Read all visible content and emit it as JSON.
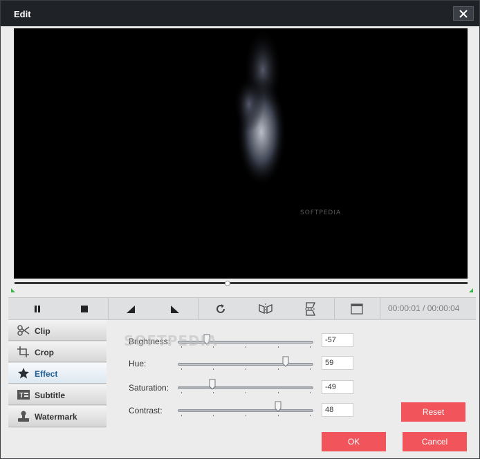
{
  "window": {
    "title": "Edit"
  },
  "preview": {
    "watermark": "SOFTPEDIA"
  },
  "player": {
    "progress": 0.47,
    "current_time": "00:00:01",
    "separator": "/",
    "total_time": "00:00:04",
    "timecode": "00:00:01 / 00:00:04"
  },
  "toolbar": {
    "icons": [
      "pause-icon",
      "stop-icon",
      "rotate-left-icon",
      "rotate-right-icon",
      "rotate-clockwise-icon",
      "flip-horizontal-icon",
      "flip-vertical-icon",
      "aspect-ratio-icon"
    ]
  },
  "sidebar": {
    "items": [
      {
        "label": "Clip",
        "icon": "scissors-icon",
        "active": false
      },
      {
        "label": "Crop",
        "icon": "crop-icon",
        "active": false
      },
      {
        "label": "Effect",
        "icon": "star-icon",
        "active": true
      },
      {
        "label": "Subtitle",
        "icon": "subtitle-icon",
        "active": false
      },
      {
        "label": "Watermark",
        "icon": "stamp-icon",
        "active": false
      }
    ]
  },
  "effect": {
    "watermark": "SOFTPEDIA",
    "brightness": {
      "label": "Brightness:",
      "value": "-57",
      "level": -57
    },
    "hue": {
      "label": "Hue:",
      "value": "59",
      "level": 59
    },
    "saturation": {
      "label": "Saturation:",
      "value": "-49",
      "level": -49
    },
    "contrast": {
      "label": "Contrast:",
      "value": "48",
      "level": 48
    },
    "reset_label": "Reset"
  },
  "footer": {
    "ok_label": "OK",
    "cancel_label": "Cancel"
  },
  "colors": {
    "accent_red": "#f2545b",
    "titlebar": "#1f2227",
    "marker_green": "#3ab34a",
    "active_label": "#1f5f9a"
  }
}
